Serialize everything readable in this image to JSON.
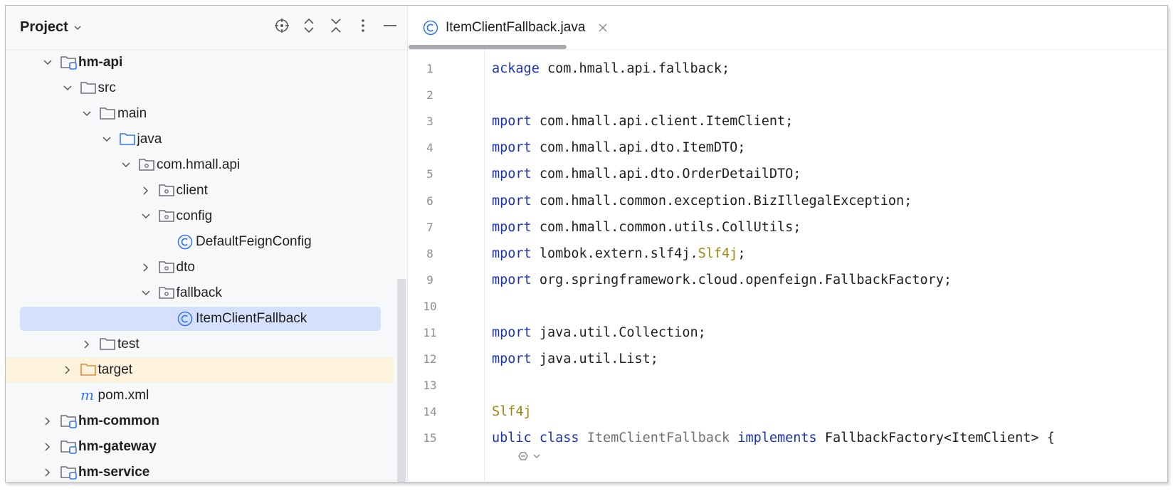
{
  "project_panel": {
    "title": "Project",
    "tools": [
      "crosshair-icon",
      "expand-all-icon",
      "collapse-all-icon",
      "more-icon",
      "minimize-icon"
    ],
    "tree": [
      {
        "label": "hm-api",
        "depth": 0,
        "expanded": true,
        "icon": "module-folder",
        "bold": true
      },
      {
        "label": "src",
        "depth": 1,
        "expanded": true,
        "icon": "folder"
      },
      {
        "label": "main",
        "depth": 2,
        "expanded": true,
        "icon": "folder"
      },
      {
        "label": "java",
        "depth": 3,
        "expanded": true,
        "icon": "source-folder"
      },
      {
        "label": "com.hmall.api",
        "depth": 4,
        "expanded": true,
        "icon": "package"
      },
      {
        "label": "client",
        "depth": 5,
        "expanded": false,
        "icon": "package"
      },
      {
        "label": "config",
        "depth": 5,
        "expanded": true,
        "icon": "package"
      },
      {
        "label": "DefaultFeignConfig",
        "depth": 6,
        "leaf": true,
        "icon": "class"
      },
      {
        "label": "dto",
        "depth": 5,
        "expanded": false,
        "icon": "package"
      },
      {
        "label": "fallback",
        "depth": 5,
        "expanded": true,
        "icon": "package"
      },
      {
        "label": "ItemClientFallback",
        "depth": 6,
        "leaf": true,
        "icon": "class",
        "selected": true
      },
      {
        "label": "test",
        "depth": 2,
        "expanded": false,
        "icon": "folder"
      },
      {
        "label": "target",
        "depth": 1,
        "expanded": false,
        "icon": "excluded-folder",
        "highlight": true
      },
      {
        "label": "pom.xml",
        "depth": 1,
        "leaf": true,
        "icon": "maven"
      },
      {
        "label": "hm-common",
        "depth": 0,
        "expanded": false,
        "icon": "module-folder",
        "bold": true
      },
      {
        "label": "hm-gateway",
        "depth": 0,
        "expanded": false,
        "icon": "module-folder",
        "bold": true
      },
      {
        "label": "hm-service",
        "depth": 0,
        "expanded": false,
        "icon": "module-folder",
        "bold": true
      }
    ]
  },
  "editor": {
    "tab_label": "ItemClientFallback.java",
    "lines": [
      {
        "n": "1",
        "parts": [
          [
            "kw",
            "ackage"
          ],
          [
            "",
            " com.hmall.api.fallback;"
          ]
        ]
      },
      {
        "n": "2",
        "parts": []
      },
      {
        "n": "3",
        "parts": [
          [
            "kw",
            "mport"
          ],
          [
            "",
            " com.hmall.api.client.ItemClient;"
          ]
        ]
      },
      {
        "n": "4",
        "parts": [
          [
            "kw",
            "mport"
          ],
          [
            "",
            " com.hmall.api.dto.ItemDTO;"
          ]
        ]
      },
      {
        "n": "5",
        "parts": [
          [
            "kw",
            "mport"
          ],
          [
            "",
            " com.hmall.api.dto.OrderDetailDTO;"
          ]
        ]
      },
      {
        "n": "6",
        "parts": [
          [
            "kw",
            "mport"
          ],
          [
            "",
            " com.hmall.common.exception.BizIllegalException;"
          ]
        ]
      },
      {
        "n": "7",
        "parts": [
          [
            "kw",
            "mport"
          ],
          [
            "",
            " com.hmall.common.utils.CollUtils;"
          ]
        ]
      },
      {
        "n": "8",
        "parts": [
          [
            "kw",
            "mport"
          ],
          [
            "",
            " lombok.extern.slf4j."
          ],
          [
            "ann",
            "Slf4j"
          ],
          [
            "",
            ";"
          ]
        ]
      },
      {
        "n": "9",
        "parts": [
          [
            "kw",
            "mport"
          ],
          [
            "",
            " org.springframework.cloud.openfeign.FallbackFactory;"
          ]
        ]
      },
      {
        "n": "10",
        "parts": []
      },
      {
        "n": "11",
        "parts": [
          [
            "kw",
            "mport"
          ],
          [
            "",
            " java.util.Collection;"
          ]
        ]
      },
      {
        "n": "12",
        "parts": [
          [
            "kw",
            "mport"
          ],
          [
            "",
            " java.util.List;"
          ]
        ]
      },
      {
        "n": "13",
        "parts": []
      },
      {
        "n": "14",
        "parts": [
          [
            "ann",
            "Slf4j"
          ]
        ]
      },
      {
        "n": "15",
        "parts": [
          [
            "kw",
            "ublic"
          ],
          [
            "",
            " "
          ],
          [
            "kw",
            "class"
          ],
          [
            "",
            " "
          ],
          [
            "gray",
            "ItemClientFallback"
          ],
          [
            "",
            " "
          ],
          [
            "kw",
            "implements"
          ],
          [
            "",
            " FallbackFactory<ItemClient> {"
          ]
        ]
      }
    ]
  },
  "colors": {
    "keyword": "#1a33b8",
    "annotation": "#9e880d",
    "selection": "#d5e1fb",
    "excluded_highlight": "#fdf3dc"
  }
}
